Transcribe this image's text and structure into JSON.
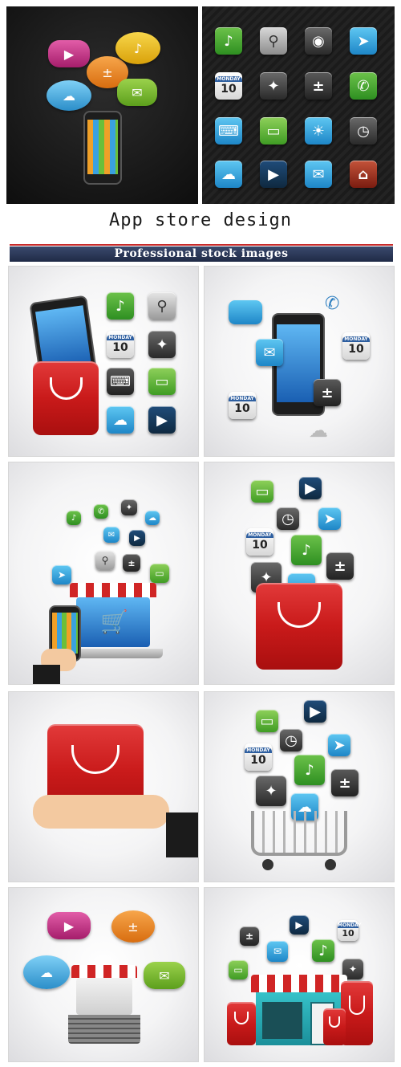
{
  "header": {
    "title": "App store design",
    "banner": "Professional   stock images"
  },
  "calendar": {
    "day": "MONDAY",
    "date": "10"
  },
  "colors": {
    "green": "#3fae3a",
    "blue": "#2f9fd8",
    "gray": "#7c7c7c",
    "red": "#c91a1a",
    "magenta": "#d0338a",
    "orange": "#f39122",
    "yellow": "#f2c21b"
  },
  "icons": [
    "music-icon",
    "search-icon",
    "compass-icon",
    "calculator-icon",
    "mail-icon",
    "cloud-icon",
    "play-icon",
    "location-arrow-icon",
    "phone-icon",
    "weather-icon",
    "clock-icon",
    "chat-icon",
    "shopping-bag-icon",
    "shopping-cart-icon"
  ]
}
